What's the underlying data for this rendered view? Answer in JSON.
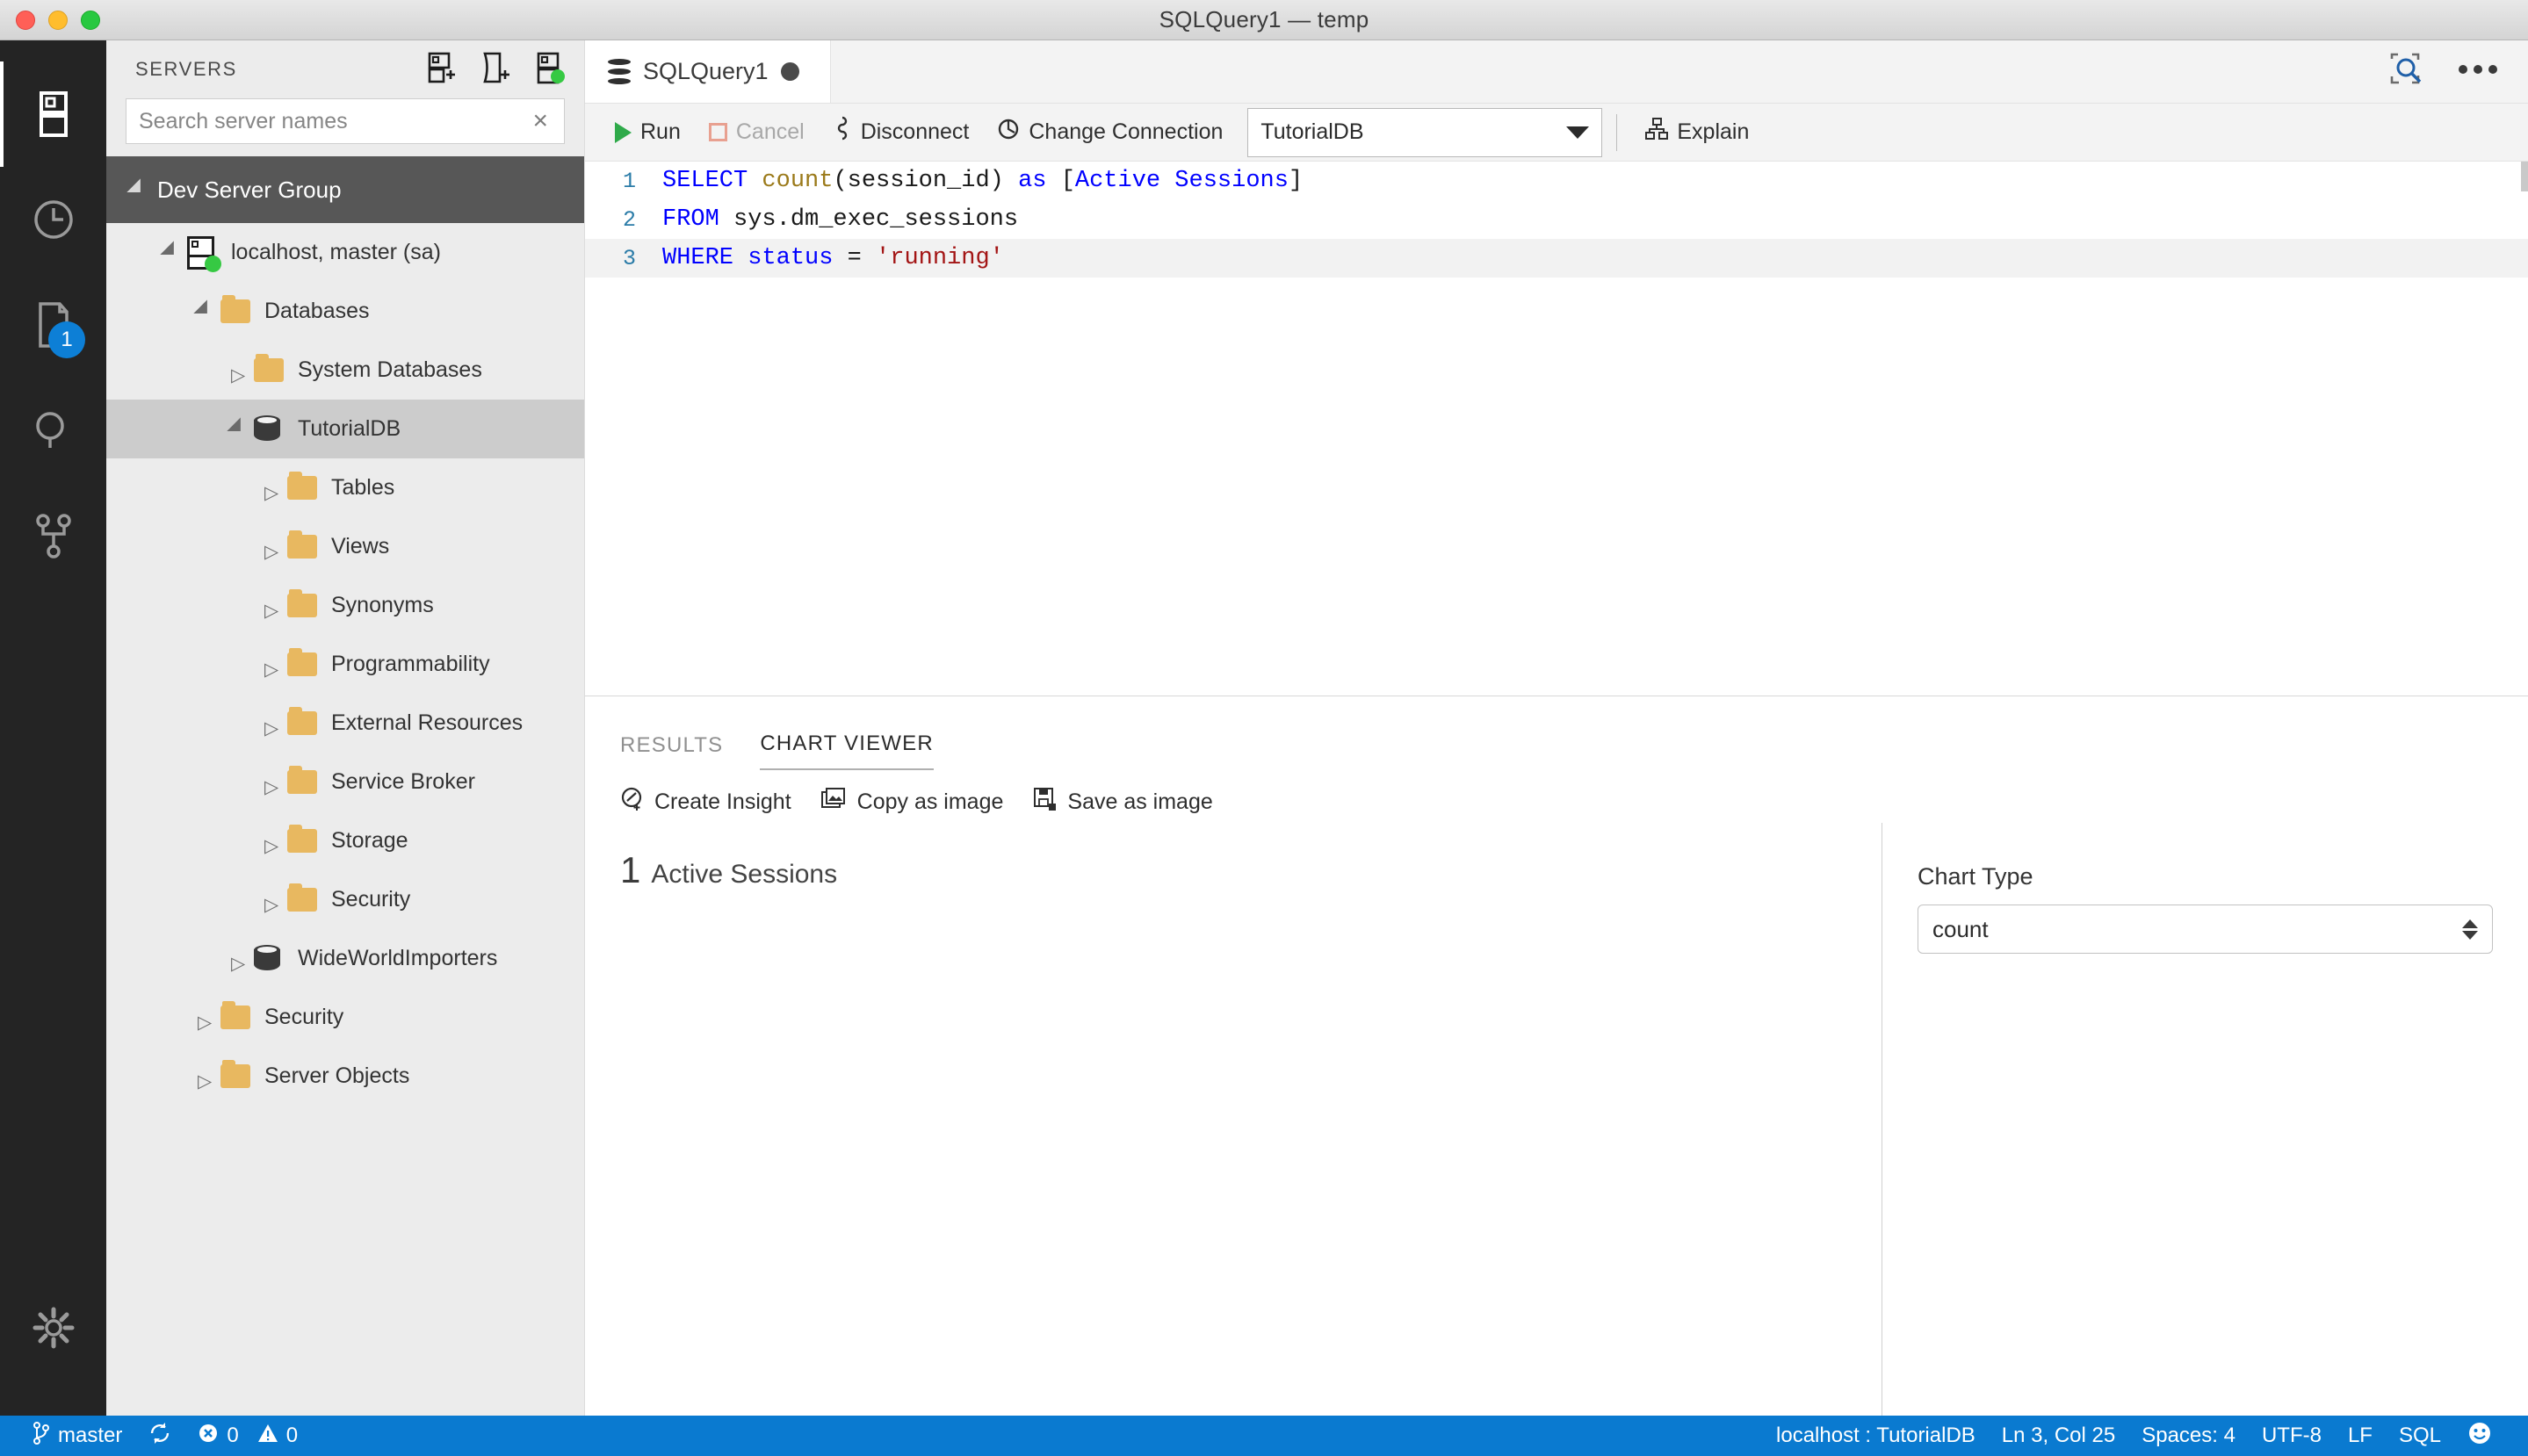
{
  "window": {
    "title": "SQLQuery1 — temp",
    "traffic_lights": [
      "close",
      "minimize",
      "zoom"
    ]
  },
  "activitybar": {
    "items": [
      {
        "name": "servers-icon",
        "label": "Servers",
        "active": true,
        "badge": null
      },
      {
        "name": "history-icon",
        "label": "History",
        "active": false,
        "badge": null
      },
      {
        "name": "tasks-icon",
        "label": "Tasks",
        "active": false,
        "badge": "1"
      },
      {
        "name": "search-icon",
        "label": "Search",
        "active": false,
        "badge": null
      },
      {
        "name": "source-control-icon",
        "label": "Source Control",
        "active": false,
        "badge": null
      }
    ],
    "settings": {
      "name": "gear-icon",
      "label": "Manage"
    }
  },
  "servers_panel": {
    "title": "SERVERS",
    "header_icons": [
      {
        "name": "new-connection-icon",
        "label": "New Connection"
      },
      {
        "name": "new-server-group-icon",
        "label": "New Server Group"
      },
      {
        "name": "connected-server-icon",
        "label": "Connected Servers"
      }
    ],
    "search": {
      "placeholder": "Search server names",
      "value": "",
      "clear_label": "×"
    },
    "tree": [
      {
        "label": "Dev Server Group",
        "indent": 0,
        "icon": "none",
        "state": "expanded",
        "kind": "group",
        "selected": false
      },
      {
        "label": "localhost, master (sa)",
        "indent": 1,
        "icon": "server",
        "state": "expanded",
        "kind": "server",
        "selected": false
      },
      {
        "label": "Databases",
        "indent": 2,
        "icon": "folder",
        "state": "expanded",
        "kind": "folder",
        "selected": false
      },
      {
        "label": "System Databases",
        "indent": 3,
        "icon": "folder",
        "state": "collapsed",
        "kind": "folder",
        "selected": false
      },
      {
        "label": "TutorialDB",
        "indent": 3,
        "icon": "database",
        "state": "expanded",
        "kind": "database",
        "selected": true
      },
      {
        "label": "Tables",
        "indent": 4,
        "icon": "folder",
        "state": "collapsed",
        "kind": "folder",
        "selected": false
      },
      {
        "label": "Views",
        "indent": 4,
        "icon": "folder",
        "state": "collapsed",
        "kind": "folder",
        "selected": false
      },
      {
        "label": "Synonyms",
        "indent": 4,
        "icon": "folder",
        "state": "collapsed",
        "kind": "folder",
        "selected": false
      },
      {
        "label": "Programmability",
        "indent": 4,
        "icon": "folder",
        "state": "collapsed",
        "kind": "folder",
        "selected": false
      },
      {
        "label": "External Resources",
        "indent": 4,
        "icon": "folder",
        "state": "collapsed",
        "kind": "folder",
        "selected": false
      },
      {
        "label": "Service Broker",
        "indent": 4,
        "icon": "folder",
        "state": "collapsed",
        "kind": "folder",
        "selected": false
      },
      {
        "label": "Storage",
        "indent": 4,
        "icon": "folder",
        "state": "collapsed",
        "kind": "folder",
        "selected": false
      },
      {
        "label": "Security",
        "indent": 4,
        "icon": "folder",
        "state": "collapsed",
        "kind": "folder",
        "selected": false
      },
      {
        "label": "WideWorldImporters",
        "indent": 3,
        "icon": "database",
        "state": "collapsed",
        "kind": "database",
        "selected": false
      },
      {
        "label": "Security",
        "indent": 2,
        "icon": "folder",
        "state": "collapsed",
        "kind": "folder",
        "selected": false
      },
      {
        "label": "Server Objects",
        "indent": 2,
        "icon": "folder",
        "state": "collapsed",
        "kind": "folder",
        "selected": false
      }
    ]
  },
  "editor": {
    "tab": {
      "label": "SQLQuery1",
      "dirty": true,
      "icon": "database-icon"
    },
    "tab_actions": [
      {
        "name": "preview-query-plan-icon",
        "label": "Query Plan"
      },
      {
        "name": "more-actions-icon",
        "label": "More Actions..."
      }
    ],
    "toolbar": {
      "run_label": "Run",
      "cancel_label": "Cancel",
      "cancel_disabled": true,
      "disconnect_label": "Disconnect",
      "change_connection_label": "Change Connection",
      "database_value": "TutorialDB",
      "explain_label": "Explain"
    },
    "code": {
      "lines": [
        {
          "number": "1",
          "current": false
        },
        {
          "number": "2",
          "current": false
        },
        {
          "number": "3",
          "current": true
        }
      ],
      "text": [
        "SELECT count(session_id) as [Active Sessions]",
        "FROM sys.dm_exec_sessions",
        "WHERE status = 'running'"
      ]
    }
  },
  "results": {
    "tabs": [
      {
        "label": "RESULTS",
        "active": false
      },
      {
        "label": "CHART VIEWER",
        "active": true
      }
    ],
    "actions": [
      {
        "name": "create-insight-icon",
        "label": "Create Insight"
      },
      {
        "name": "copy-as-image-icon",
        "label": "Copy as image"
      },
      {
        "name": "save-as-image-icon",
        "label": "Save as image"
      }
    ],
    "options": {
      "chart_type_label": "Chart Type",
      "chart_type_value": "count"
    }
  },
  "chart_data": {
    "type": "table",
    "title": "",
    "categories": [
      "Active Sessions"
    ],
    "values": [
      1
    ],
    "value_display": "1",
    "label_display": "Active Sessions",
    "xlabel": "",
    "ylabel": "",
    "legend": [],
    "grid": false
  },
  "statusbar": {
    "branch": "master",
    "sync_icon": "sync-icon",
    "errors": "0",
    "warnings": "0",
    "connection": "localhost : TutorialDB",
    "position": "Ln 3, Col 25",
    "indent": "Spaces: 4",
    "encoding": "UTF-8",
    "eol": "LF",
    "language": "SQL",
    "feedback_icon": "smiley-icon",
    "background": "#0a7ad0"
  },
  "colors": {
    "accent": "#0a7ad0",
    "keyword": "#0000ff",
    "function": "#9b7a1a",
    "string": "#a31515",
    "run_green": "#2faa4a",
    "folder": "#e8b860"
  }
}
